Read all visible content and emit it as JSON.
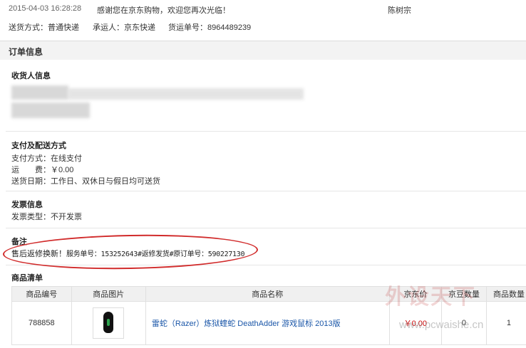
{
  "top": {
    "log_time": "2015-04-03 16:28:28",
    "log_message": "感谢您在京东购物，欢迎您再次光临！",
    "log_user": "陈树宗",
    "ship_method_label": "送货方式：",
    "ship_method": "普通快递",
    "carrier_label": "承运人：",
    "carrier": "京东快递",
    "tracking_label": "货运单号：",
    "tracking": "8964489239"
  },
  "section_title": "订单信息",
  "receiver": {
    "title": "收货人信息"
  },
  "payment": {
    "title": "支付及配送方式",
    "method_label": "支付方式：",
    "method": "在线支付",
    "freight_label": "运　　费：",
    "freight": "￥0.00",
    "date_label": "送货日期：",
    "date": "工作日、双休日与假日均可送货"
  },
  "invoice": {
    "title": "发票信息",
    "type_label": "发票类型：",
    "type": "不开发票"
  },
  "note": {
    "title": "备注",
    "text_prefix": "售后返修换新！",
    "text_body": "服务单号：153252643#返修发货#原订单号：590227130"
  },
  "goods": {
    "title": "商品清单",
    "headers": [
      "商品编号",
      "商品图片",
      "商品名称",
      "京东价",
      "京豆数量",
      "商品数量"
    ],
    "rows": [
      {
        "id": "788858",
        "name": "雷蛇（Razer）炼狱蝰蛇 DeathAdder 游戏鼠标 2013版",
        "price": "￥0.00",
        "beans": "0",
        "qty": "1"
      }
    ]
  },
  "watermark": {
    "brand": "外设天下",
    "url": "www.pcwaishe.cn"
  },
  "colors": {
    "link": "#1a56a8",
    "price": "#cc0000",
    "annotation": "#d12b2b",
    "section_bg": "#f3f3f3"
  }
}
